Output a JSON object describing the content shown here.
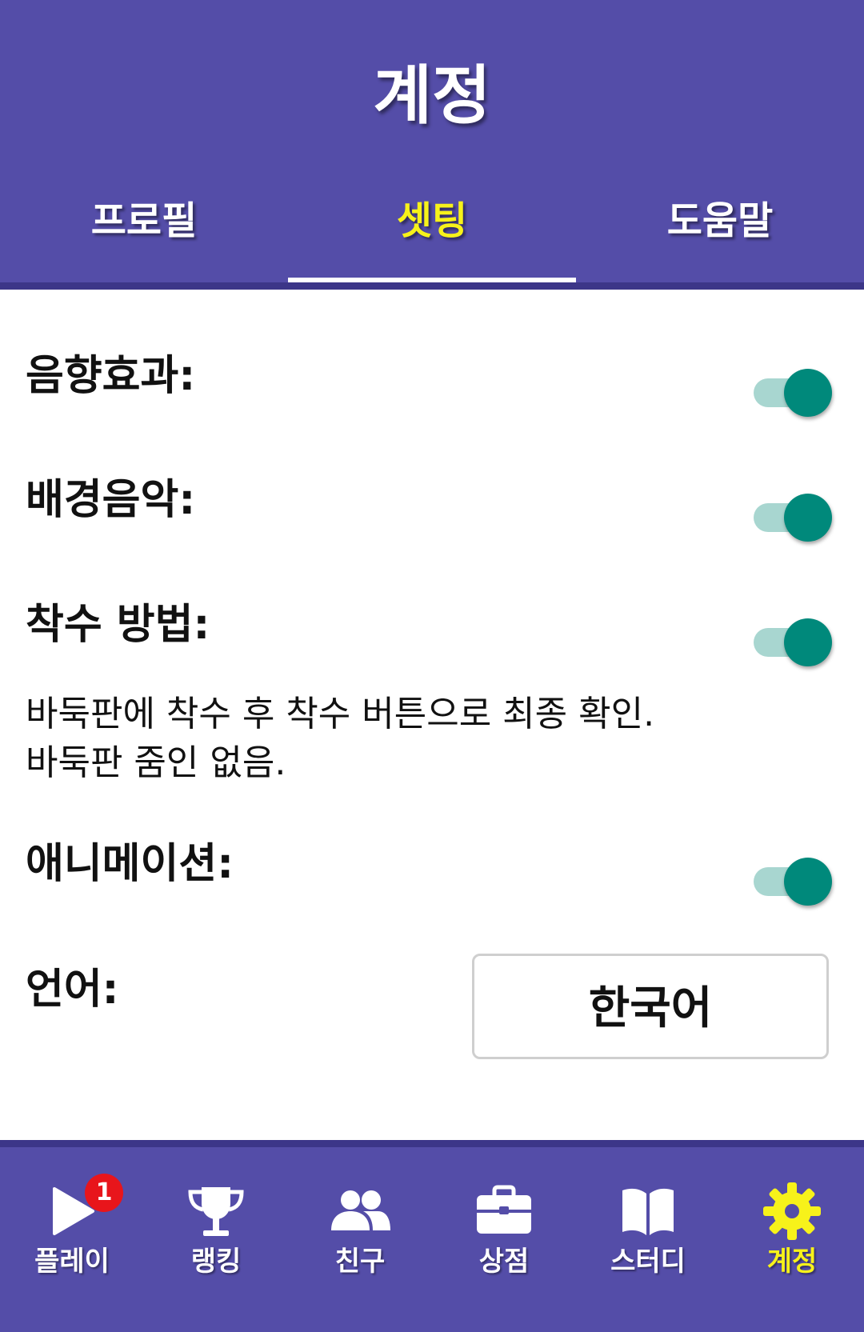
{
  "header": {
    "title": "계정",
    "tabs": [
      {
        "label": "프로필"
      },
      {
        "label": "셋팅"
      },
      {
        "label": "도움말"
      }
    ]
  },
  "settings": {
    "sound_effects": {
      "label": "음향효과:",
      "enabled": true
    },
    "background_music": {
      "label": "배경음악:",
      "enabled": true
    },
    "move_method": {
      "label": "착수 방법:",
      "enabled": true,
      "description_line1": "바둑판에 착수 후 착수 버튼으로 최종 확인.",
      "description_line2": "바둑판 줌인 없음."
    },
    "animation": {
      "label": "애니메이션:",
      "enabled": true
    },
    "language": {
      "label": "언어:",
      "value": "한국어"
    }
  },
  "bottom_nav": {
    "items": [
      {
        "label": "플레이",
        "icon": "play-icon",
        "badge": "1"
      },
      {
        "label": "랭킹",
        "icon": "trophy-icon"
      },
      {
        "label": "친구",
        "icon": "friends-icon"
      },
      {
        "label": "상점",
        "icon": "shop-briefcase-icon"
      },
      {
        "label": "스터디",
        "icon": "book-icon"
      },
      {
        "label": "계정",
        "icon": "gear-icon"
      }
    ]
  },
  "colors": {
    "primary": "#544da8",
    "primary_dark": "#3c3688",
    "active_tab": "#f7f21a",
    "toggle_thumb": "#00897b",
    "toggle_track": "#a8d6d0",
    "badge": "#e8151b"
  }
}
